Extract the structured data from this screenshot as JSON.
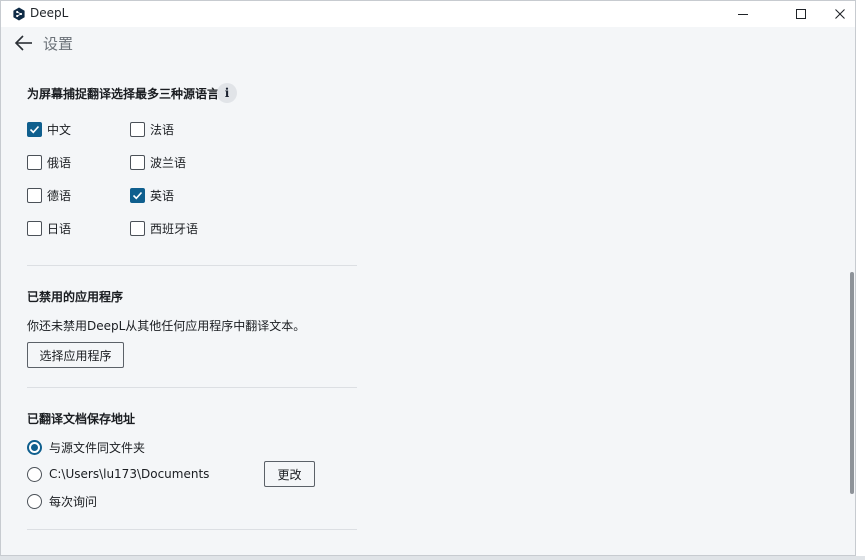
{
  "window": {
    "title": "DeepL"
  },
  "header": {
    "title": "设置"
  },
  "screen_capture": {
    "heading": "为屏幕捕捉翻译选择最多三种源语言",
    "info_icon": "i",
    "languages": [
      {
        "label": "中文",
        "checked": true
      },
      {
        "label": "法语",
        "checked": false
      },
      {
        "label": "俄语",
        "checked": false
      },
      {
        "label": "波兰语",
        "checked": false
      },
      {
        "label": "德语",
        "checked": false
      },
      {
        "label": "英语",
        "checked": true
      },
      {
        "label": "日语",
        "checked": false
      },
      {
        "label": "西班牙语",
        "checked": false
      }
    ]
  },
  "disabled_apps": {
    "heading": "已禁用的应用程序",
    "description": "你还未禁用DeepL从其他任何应用程序中翻译文本。",
    "button_label": "选择应用程序"
  },
  "save_location": {
    "heading": "已翻译文档保存地址",
    "options": [
      {
        "label": "与源文件同文件夹",
        "selected": true
      },
      {
        "label": "C:\\Users\\lu173\\Documents",
        "selected": false
      },
      {
        "label": "每次询问",
        "selected": false
      }
    ],
    "change_button_label": "更改"
  },
  "colors": {
    "accent": "#0f5f8e",
    "window_bg": "#f4f6f8",
    "titlebar_bg": "#ffffff"
  },
  "icons": {
    "app_logo": "deepl-logo-icon",
    "back": "arrow-left-icon",
    "minimize": "minimize-icon",
    "maximize": "maximize-icon",
    "close": "close-icon",
    "info": "info-icon",
    "check": "check-icon"
  }
}
